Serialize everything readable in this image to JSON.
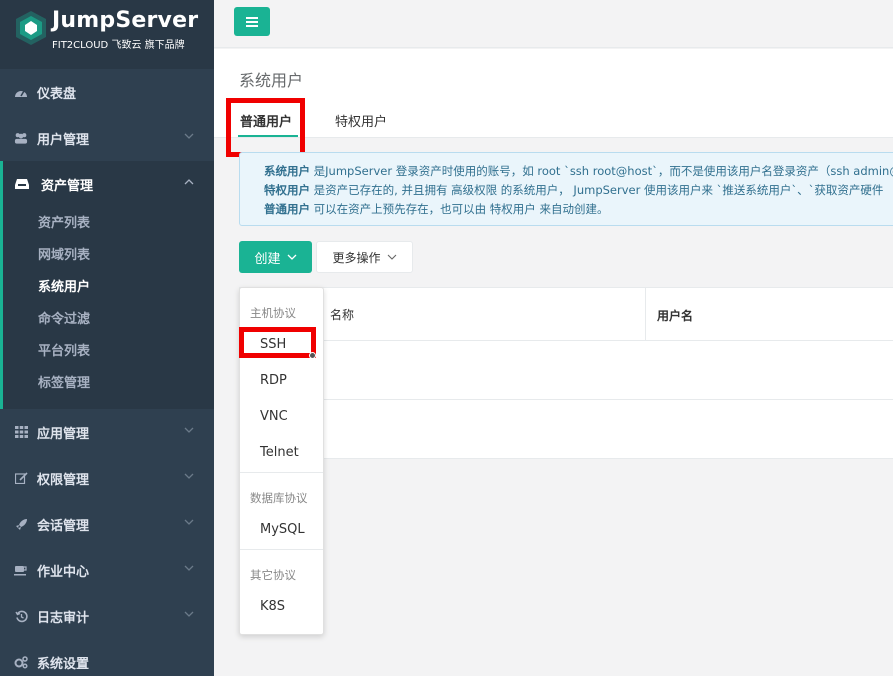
{
  "brand": {
    "title": "JumpServer",
    "subtitle": "FIT2CLOUD 飞致云 旗下品牌"
  },
  "sidebar": {
    "items": [
      {
        "label": "仪表盘",
        "icon": "dashboard-icon"
      },
      {
        "label": "用户管理",
        "icon": "users-icon"
      },
      {
        "label": "资产管理",
        "icon": "inbox-icon"
      },
      {
        "label": "应用管理",
        "icon": "grid-icon"
      },
      {
        "label": "权限管理",
        "icon": "edit-icon"
      },
      {
        "label": "会话管理",
        "icon": "rocket-icon"
      },
      {
        "label": "作业中心",
        "icon": "coffee-icon"
      },
      {
        "label": "日志审计",
        "icon": "history-icon"
      },
      {
        "label": "系统设置",
        "icon": "gears-icon"
      }
    ],
    "submenu": [
      {
        "label": "资产列表"
      },
      {
        "label": "网域列表"
      },
      {
        "label": "系统用户"
      },
      {
        "label": "命令过滤"
      },
      {
        "label": "平台列表"
      },
      {
        "label": "标签管理"
      }
    ]
  },
  "header": {
    "title": "系统用户",
    "tabs": [
      {
        "label": "普通用户"
      },
      {
        "label": "特权用户"
      }
    ]
  },
  "info": {
    "line1_bold": "系统用户",
    "line1_text": " 是JumpServer 登录资产时使用的账号，如 root `ssh root@host`，而不是使用该用户名登录资产（ssh admin@",
    "line2_bold": "特权用户",
    "line2_text": " 是资产已存在的, 并且拥有 高级权限 的系统用户， JumpServer 使用该用户来 `推送系统用户`、`获取资产硬件",
    "line3_bold": "普通用户",
    "line3_text": " 可以在资产上预先存在，也可以由 特权用户 来自动创建。"
  },
  "toolbar": {
    "create_label": "创建",
    "more_label": "更多操作"
  },
  "table": {
    "columns": [
      "名称",
      "用户名"
    ]
  },
  "dropdown": {
    "groups": [
      {
        "header": "主机协议",
        "items": [
          "SSH",
          "RDP",
          "VNC",
          "Telnet"
        ]
      },
      {
        "header": "数据库协议",
        "items": [
          "MySQL"
        ]
      },
      {
        "header": "其它协议",
        "items": [
          "K8S"
        ]
      }
    ]
  },
  "colors": {
    "sidebar_bg": "#2f4050",
    "accent": "#1ab394",
    "highlight": "#f00000",
    "info_text": "#31708f"
  }
}
